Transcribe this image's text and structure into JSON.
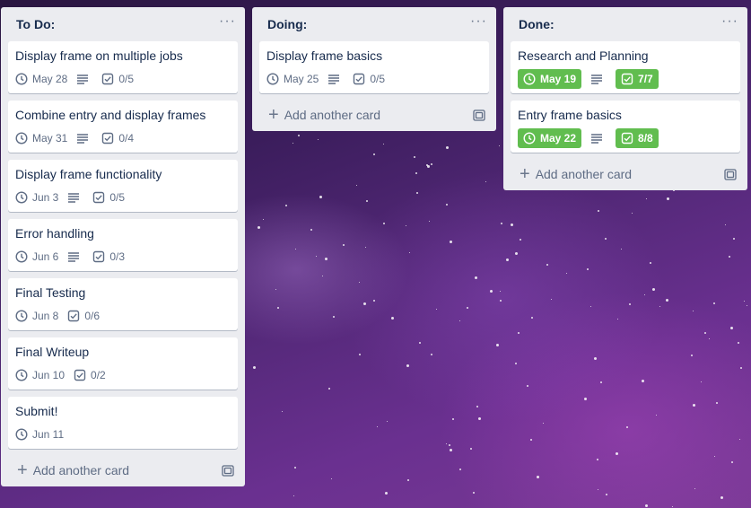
{
  "lists": [
    {
      "title": "To Do:",
      "menu": "···",
      "cards": [
        {
          "title": "Display frame on multiple jobs",
          "due": "May 28",
          "checklist": "0/5",
          "has_desc": true
        },
        {
          "title": "Combine entry and display frames",
          "due": "May 31",
          "checklist": "0/4",
          "has_desc": true
        },
        {
          "title": "Display frame functionality",
          "due": "Jun 3",
          "checklist": "0/5",
          "has_desc": true
        },
        {
          "title": "Error handling",
          "due": "Jun 6",
          "checklist": "0/3",
          "has_desc": true
        },
        {
          "title": "Final Testing",
          "due": "Jun 8",
          "checklist": "0/6",
          "has_desc": false
        },
        {
          "title": "Final Writeup",
          "due": "Jun 10",
          "checklist": "0/2",
          "has_desc": false
        },
        {
          "title": "Submit!",
          "due": "Jun 11",
          "checklist": null,
          "has_desc": false
        }
      ],
      "add_label": "Add another card"
    },
    {
      "title": "Doing:",
      "menu": "···",
      "cards": [
        {
          "title": "Display frame basics",
          "due": "May 25",
          "checklist": "0/5",
          "has_desc": true
        }
      ],
      "add_label": "Add another card"
    },
    {
      "title": "Done:",
      "menu": "···",
      "cards": [
        {
          "title": "Research and Planning",
          "due": "May 19",
          "checklist": "7/7",
          "has_desc": true,
          "complete": true
        },
        {
          "title": "Entry frame basics",
          "due": "May 22",
          "checklist": "8/8",
          "has_desc": true,
          "complete": true
        }
      ],
      "add_label": "Add another card"
    }
  ],
  "colors": {
    "complete_badge": "#61bd4f",
    "list_bg": "#ebecf0",
    "text": "#172b4d"
  },
  "icons": {
    "due": "clock-icon",
    "description": "description-icon",
    "checklist": "checklist-icon",
    "add": "plus-icon",
    "template": "card-template-icon",
    "menu": "more-icon"
  }
}
